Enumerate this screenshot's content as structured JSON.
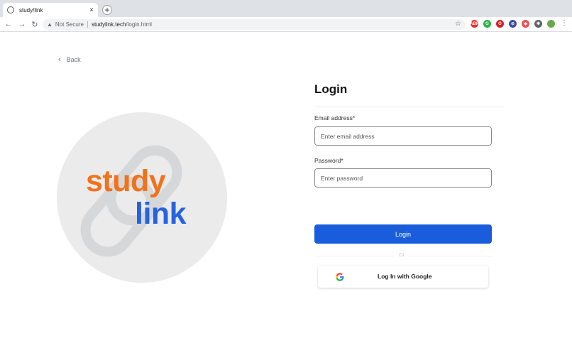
{
  "browser": {
    "tab_title": "study/link",
    "tab_close": "×",
    "new_tab": "+",
    "security_label": "Not Secure",
    "url_host": "studylink.tech",
    "url_path": "/login.html",
    "extensions": [
      {
        "name": "adblock-icon",
        "label": "ABP",
        "color": "#e8302e"
      },
      {
        "name": "grammar-icon",
        "label": "G",
        "color": "#2db24a"
      },
      {
        "name": "opera-icon",
        "label": "O",
        "color": "#d91f26"
      },
      {
        "name": "block-icon",
        "label": "⊘",
        "color": "#3f4f9c"
      },
      {
        "name": "shield-icon",
        "label": "◆",
        "color": "#f0524f"
      },
      {
        "name": "puzzle-icon",
        "label": "✱",
        "color": "#5f6368"
      },
      {
        "name": "profile-avatar",
        "label": "",
        "color": "#6aa84f"
      }
    ]
  },
  "page": {
    "back_label": "Back",
    "logo_word_1": "study",
    "logo_word_2": "link",
    "title": "Login",
    "email_label": "Email address*",
    "email_placeholder": "Enter email address",
    "password_label": "Password*",
    "password_placeholder": "Enter password",
    "login_button": "Login",
    "divider_text": "Or",
    "google_button": "Log In with Google"
  },
  "colors": {
    "accent_blue": "#1a5ddc",
    "logo_orange": "#f0721b",
    "logo_blue": "#2763e0"
  }
}
